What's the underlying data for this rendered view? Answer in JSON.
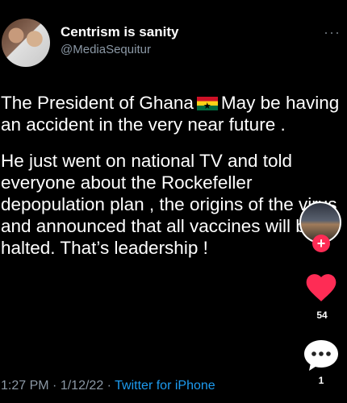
{
  "author": {
    "display_name": "Centrism is sanity",
    "handle": "@MediaSequitur"
  },
  "more_icon": "···",
  "tweet": {
    "p1_before_flag": "The President of Ghana",
    "p1_flag_icon": "ghana-flag",
    "p1_after_flag": "May be having an accident in the very near future .",
    "p2": "He just went on national TV and told everyone about the Rockefeller depopulation plan , the origins of the virus and announced that all vaccines will be halted. That’s leadership !"
  },
  "meta": {
    "time": "1:27 PM",
    "sep1": "·",
    "date": "1/12/22",
    "sep2": "·",
    "source": "Twitter for iPhone"
  },
  "overlay": {
    "follow_plus": "+",
    "like_count": "54",
    "comment_count": "1"
  },
  "colors": {
    "background": "#000000",
    "link": "#1d9bf0",
    "secondary_text": "#8b98a5",
    "like_red": "#fe2c55"
  }
}
